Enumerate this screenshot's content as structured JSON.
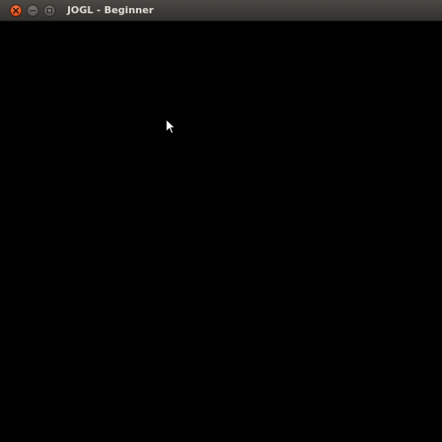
{
  "window": {
    "title": "JOGL - Beginner",
    "background_color": "#000000"
  },
  "titlebar": {
    "controls": [
      {
        "name": "close",
        "icon": "close-icon",
        "color": "#e25420"
      },
      {
        "name": "minimize",
        "icon": "minimize-icon",
        "color": "#5a5955"
      },
      {
        "name": "maximize",
        "icon": "maximize-icon",
        "color": "#5a5955"
      }
    ]
  },
  "pointer": {
    "icon": "arrow-cursor-icon"
  }
}
